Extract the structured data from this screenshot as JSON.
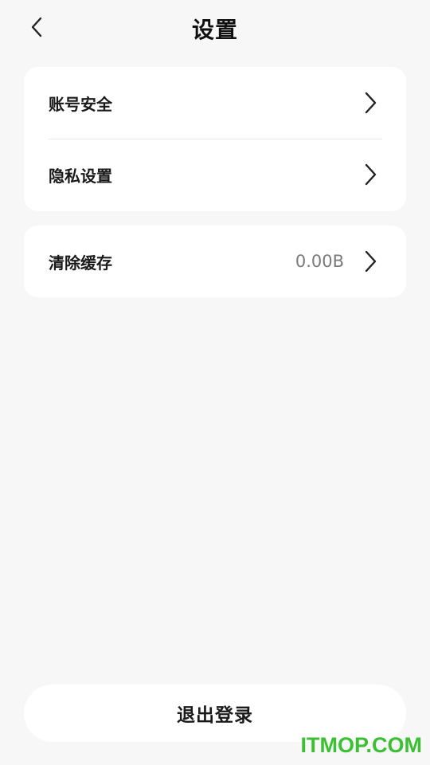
{
  "header": {
    "title": "设置",
    "back_icon": "chevron-left-icon"
  },
  "settings_group_1": {
    "items": [
      {
        "label": "账号安全",
        "icon": "chevron-right-icon"
      },
      {
        "label": "隐私设置",
        "icon": "chevron-right-icon"
      }
    ]
  },
  "settings_group_2": {
    "items": [
      {
        "label": "清除缓存",
        "value": "0.00B",
        "icon": "chevron-right-icon"
      }
    ]
  },
  "logout": {
    "label": "退出登录"
  },
  "watermark": {
    "text": "ITMOP.COM",
    "color": "#3bbf33"
  },
  "colors": {
    "background": "#f6f7f6",
    "card": "#ffffff",
    "text": "#1a1a1a",
    "muted": "#7a7a7a"
  }
}
